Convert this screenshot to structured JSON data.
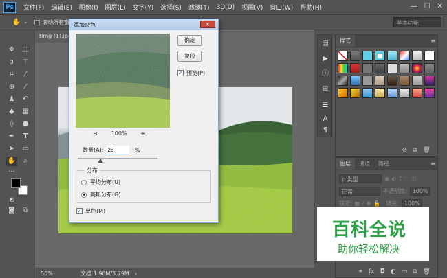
{
  "app": {
    "logo": "Ps"
  },
  "menubar": {
    "items": [
      "文件(F)",
      "编辑(E)",
      "图像(I)",
      "图层(L)",
      "文字(Y)",
      "选择(S)",
      "滤镜(T)",
      "3D(D)",
      "视图(V)",
      "窗口(W)",
      "帮助(H)"
    ]
  },
  "options_bar": {
    "scroll_all_label": "滚动所有窗口",
    "workspace": "基本功能"
  },
  "document": {
    "tab_title": "timg (1).jpg"
  },
  "status_bar": {
    "zoom": "50%",
    "doc_info": "文档:1.90M/3.79M"
  },
  "dialog": {
    "title": "添加杂色",
    "ok_label": "确定",
    "reset_label": "复位",
    "preview_label": "预览(P)",
    "preview_checked": true,
    "zoom_level": "100%",
    "amount_label": "数量(A):",
    "amount_value": "25",
    "amount_unit": "%",
    "amount_fraction_of_slider": 0.25,
    "distribution_label": "分布",
    "uniform_label": "平均分布(U)",
    "gaussian_label": "高斯分布(G)",
    "selected_distribution": "gaussian",
    "mono_label": "单色(M)",
    "mono_checked": true
  },
  "styles_panel": {
    "tab": "样式"
  },
  "layers_panel": {
    "tabs": [
      "图层",
      "通道",
      "路径"
    ],
    "filter_label": "ρ 类型",
    "blend_mode": "正常",
    "opacity_label": "不透明度:",
    "opacity_value": "100%",
    "lock_label": "锁定:",
    "fill_label": "填充:",
    "fill_value": "100%"
  },
  "watermark": {
    "title": "百科全说",
    "subtitle": "助你轻松解决"
  },
  "colors": {
    "accent": "#31a8ff",
    "watermark_green": "#2ea046",
    "foreground": "#000000",
    "background": "#ffffff"
  }
}
